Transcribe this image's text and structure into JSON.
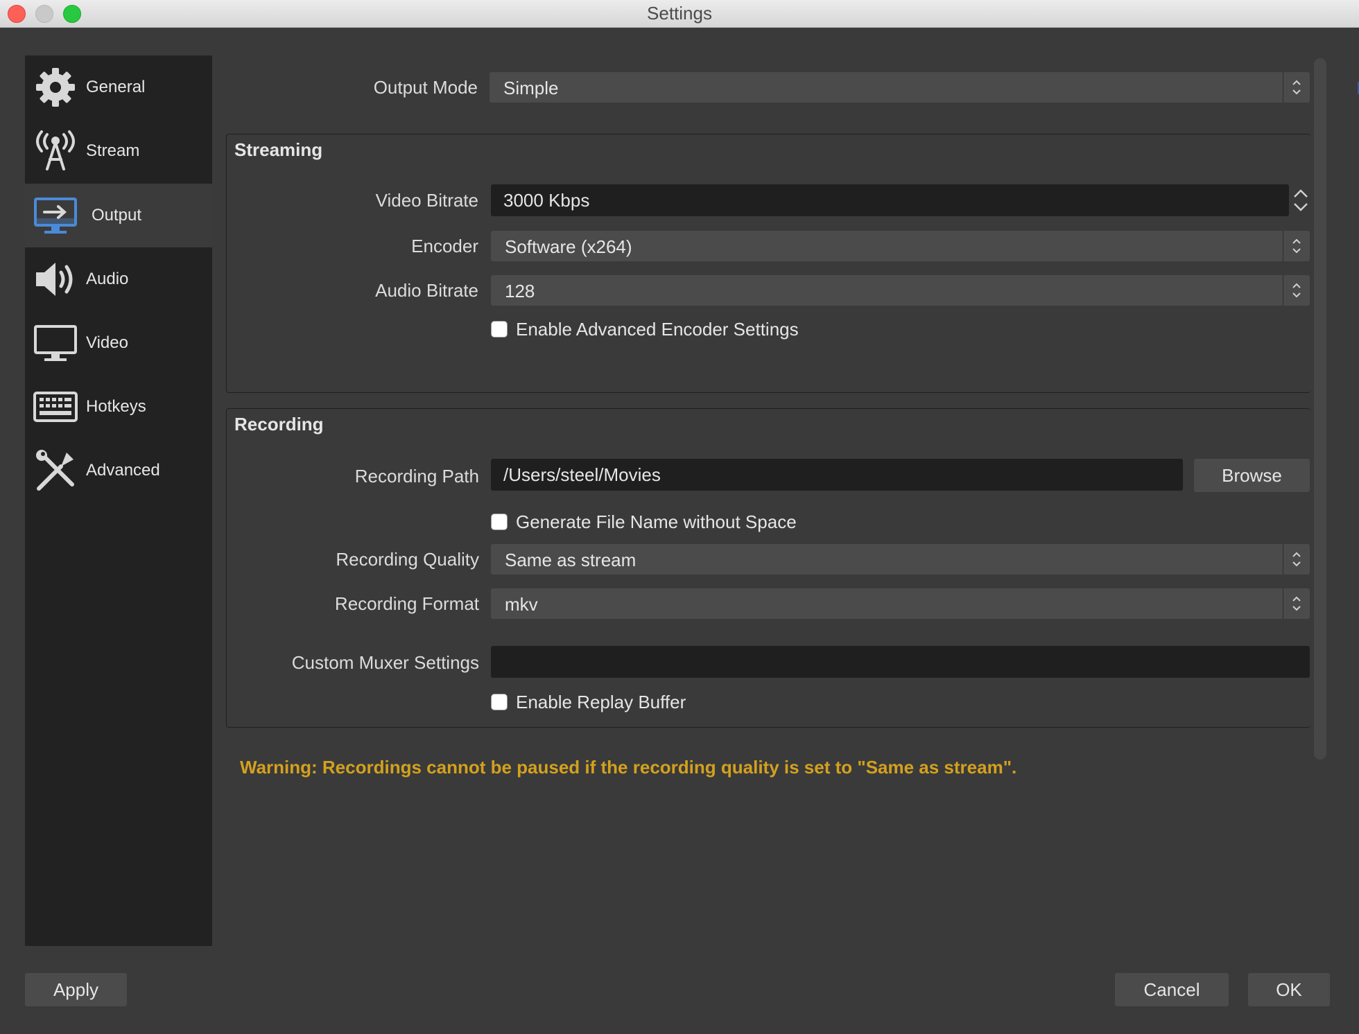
{
  "window": {
    "title": "Settings"
  },
  "sidebar": {
    "items": [
      {
        "label": "General",
        "icon": "gear-icon"
      },
      {
        "label": "Stream",
        "icon": "antenna-icon"
      },
      {
        "label": "Output",
        "icon": "output-monitor-icon",
        "active": true
      },
      {
        "label": "Audio",
        "icon": "speaker-icon"
      },
      {
        "label": "Video",
        "icon": "monitor-icon"
      },
      {
        "label": "Hotkeys",
        "icon": "keyboard-icon"
      },
      {
        "label": "Advanced",
        "icon": "tools-icon"
      }
    ]
  },
  "output_mode": {
    "label": "Output Mode",
    "value": "Simple"
  },
  "streaming": {
    "title": "Streaming",
    "video_bitrate": {
      "label": "Video Bitrate",
      "value": "3000 Kbps"
    },
    "encoder": {
      "label": "Encoder",
      "value": "Software (x264)"
    },
    "audio_bitrate": {
      "label": "Audio Bitrate",
      "value": "128"
    },
    "advanced_encoder": {
      "label": "Enable Advanced Encoder Settings",
      "checked": false
    }
  },
  "recording": {
    "title": "Recording",
    "path": {
      "label": "Recording Path",
      "value": "/Users/steel/Movies",
      "browse": "Browse"
    },
    "no_space": {
      "label": "Generate File Name without Space",
      "checked": false
    },
    "quality": {
      "label": "Recording Quality",
      "value": "Same as stream"
    },
    "format": {
      "label": "Recording Format",
      "value": "mkv"
    },
    "muxer": {
      "label": "Custom Muxer Settings",
      "value": ""
    },
    "replay_buffer": {
      "label": "Enable Replay Buffer",
      "checked": false
    }
  },
  "warning": "Warning: Recordings cannot be paused if the recording quality is set to \"Same as stream\".",
  "footer": {
    "apply": "Apply",
    "cancel": "Cancel",
    "ok": "OK"
  },
  "colors": {
    "warning": "#d4a11e",
    "panel_bg": "#3a3a3a",
    "sidebar_bg": "#222222"
  }
}
